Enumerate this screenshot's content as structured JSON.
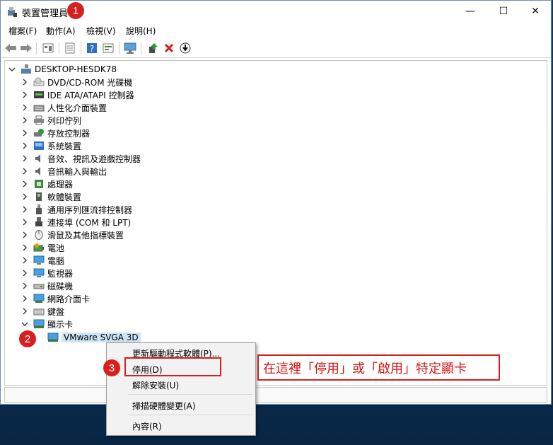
{
  "window": {
    "title": "裝置管理員",
    "minimize": "—",
    "maximize": "☐",
    "close": "✕"
  },
  "menu": [
    "檔案(F)",
    "動作(A)",
    "檢視(V)",
    "說明(H)"
  ],
  "toolbar_icons": [
    "back-icon",
    "forward-icon",
    "properties-icon",
    "view-icon",
    "help-icon",
    "action-icon",
    "monitor-icon",
    "update-driver-icon",
    "uninstall-icon",
    "download-icon"
  ],
  "tree": {
    "root": "DESKTOP-HESDK78",
    "categories": [
      "DVD/CD-ROM 光碟機",
      "IDE ATA/ATAPI 控制器",
      "人性化介面裝置",
      "列印佇列",
      "存放控制器",
      "系統裝置",
      "音效、視訊及遊戲控制器",
      "音訊輸入與輸出",
      "處理器",
      "軟體裝置",
      "通用序列匯流排控制器",
      "連接埠 (COM 和 LPT)",
      "滑鼠及其他指標裝置",
      "電池",
      "電腦",
      "監視器",
      "磁碟機",
      "網路介面卡",
      "鍵盤",
      "顯示卡"
    ],
    "expanded_child": "VMware SVGA 3D"
  },
  "context_menu": {
    "update": "更新驅動程式軟體(P)...",
    "disable": "停用(D)",
    "uninstall": "解除安裝(U)",
    "scan": "掃描硬體變更(A)",
    "properties": "內容(R)"
  },
  "annotations": {
    "badge1": "1",
    "badge2": "2",
    "badge3": "3",
    "note": "在這裡「停用」或「啟用」特定顯卡"
  },
  "colors": {
    "accent_red": "#d52020",
    "selection": "#cce4f7"
  }
}
